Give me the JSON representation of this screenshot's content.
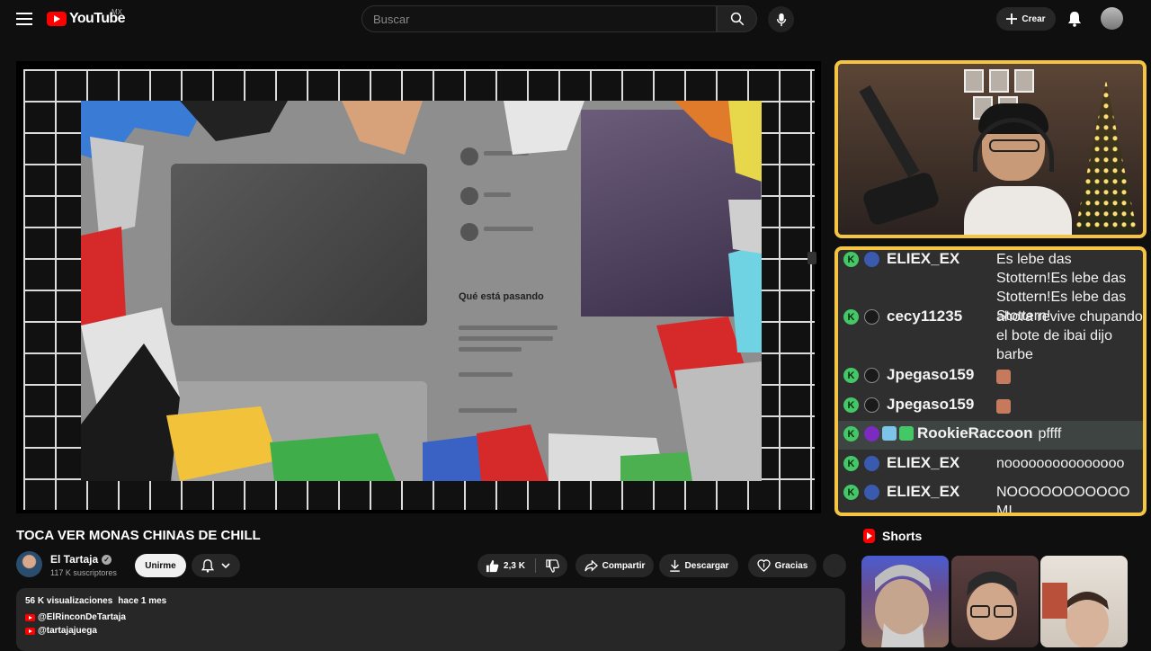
{
  "header": {
    "logo_text": "YouTube",
    "country_code": "MX",
    "search_placeholder": "Buscar",
    "create_label": "Crear"
  },
  "video_overlay": {
    "tweet_heading": "Qué está pasando"
  },
  "chat": {
    "messages": [
      {
        "user": "ELIEX_EX",
        "text": "Es lebe das Stottern!Es lebe das Stottern!Es lebe das Stottern!"
      },
      {
        "user": "cecy11235",
        "text": "ahora revive chupando el bote de ibai dijo barbe"
      },
      {
        "user": "Jpegaso159",
        "text": ""
      },
      {
        "user": "Jpegaso159",
        "text": ""
      },
      {
        "user": "RookieRaccoon",
        "text": "pffff"
      },
      {
        "user": "ELIEX_EX",
        "text": "nooooooooooooooo"
      },
      {
        "user": "ELIEX_EX",
        "text": "NOOOOOOOOOOO MI COMPAAAAAAAAAAAA"
      }
    ],
    "badge_letter": "K"
  },
  "video": {
    "title": "TOCA VER MONAS CHINAS DE CHILL",
    "channel_name": "El Tartaja",
    "subscribers": "117 K suscriptores",
    "join_label": "Unirme",
    "likes": "2,3 K",
    "share_label": "Compartir",
    "download_label": "Descargar",
    "thanks_label": "Gracias"
  },
  "description": {
    "views": "56 K visualizaciones",
    "date": "hace 1 mes",
    "links": [
      "@ElRinconDeTartaja",
      "@tartajajuega"
    ]
  },
  "shorts": {
    "heading": "Shorts"
  },
  "colors": {
    "accent_frame": "#f5c542",
    "brand_red": "#ff0000",
    "badge_green": "#44c767",
    "background": "#0f0f0f"
  }
}
